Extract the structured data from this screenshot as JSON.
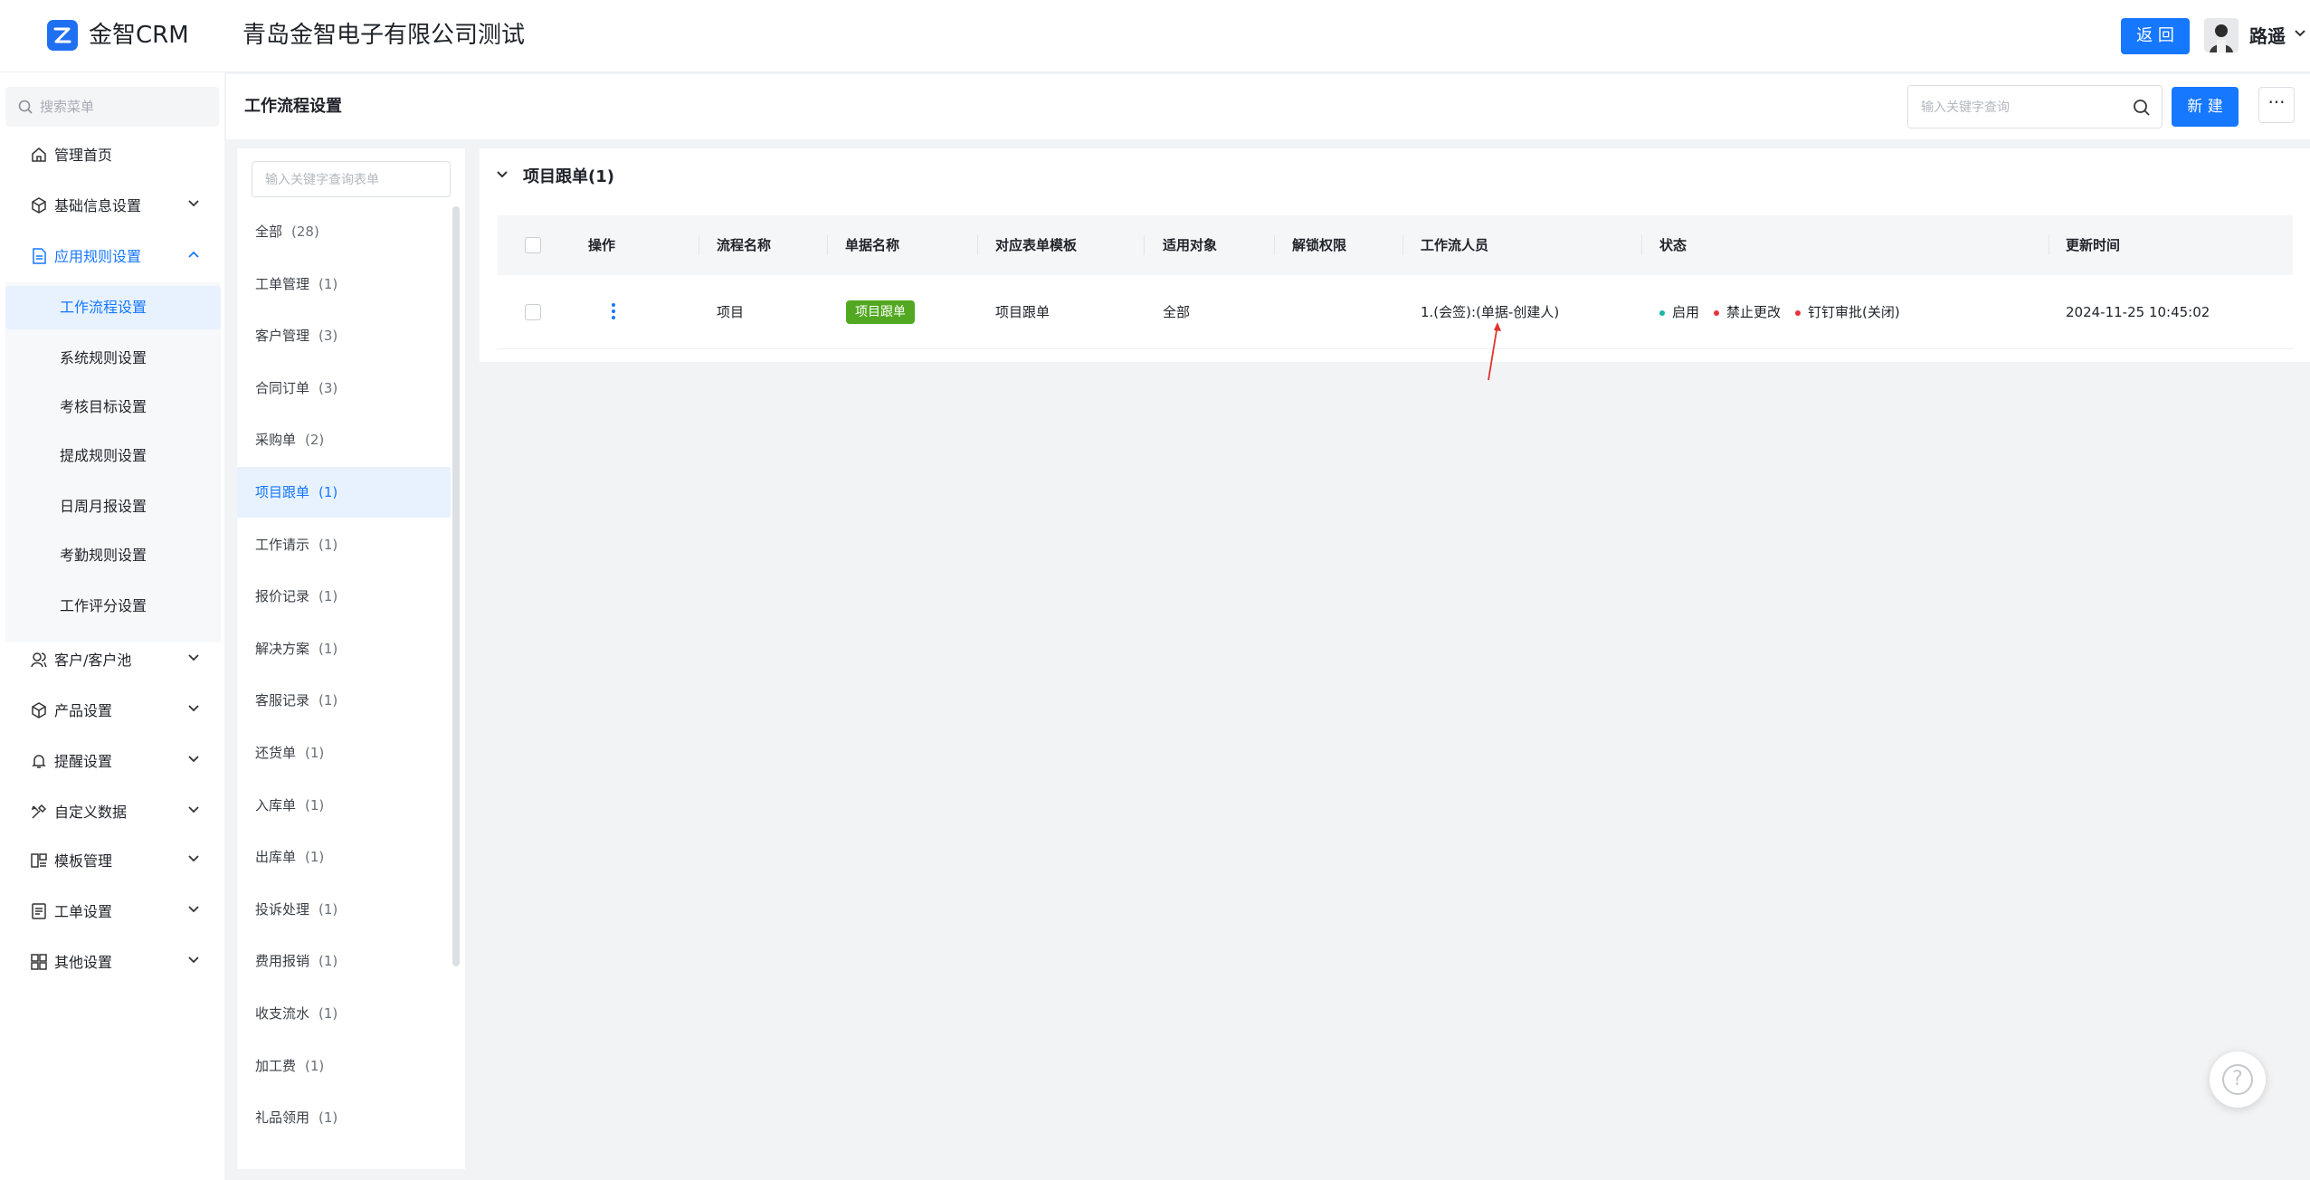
{
  "header": {
    "logo_text": "金智CRM",
    "company": "青岛金智电子有限公司测试",
    "back_label": "返 回",
    "user_name": "路遥",
    "brand_color": "#1677ff"
  },
  "sidebar": {
    "search_placeholder": "搜索菜单",
    "items": [
      {
        "label": "管理首页",
        "icon": "home-icon"
      },
      {
        "label": "基础信息设置",
        "icon": "cube-icon"
      },
      {
        "label": "应用规则设置",
        "icon": "document-icon"
      },
      {
        "label": "客户/客户池",
        "icon": "users-icon"
      },
      {
        "label": "产品设置",
        "icon": "box-icon"
      },
      {
        "label": "提醒设置",
        "icon": "bell-icon"
      },
      {
        "label": "自定义数据",
        "icon": "tools-icon"
      },
      {
        "label": "模板管理",
        "icon": "template-icon"
      },
      {
        "label": "工单设置",
        "icon": "form-icon"
      },
      {
        "label": "其他设置",
        "icon": "grid-icon"
      }
    ],
    "sub_items": [
      "工作流程设置",
      "系统规则设置",
      "考核目标设置",
      "提成规则设置",
      "日周月报设置",
      "考勤规则设置",
      "工作评分设置"
    ]
  },
  "page": {
    "title": "工作流程设置",
    "search_placeholder": "输入关键字查询",
    "new_label": "新 建",
    "more_label": "···"
  },
  "categories": {
    "search_placeholder": "输入关键字查询表单",
    "items": [
      {
        "label": "全部",
        "count": "(28)"
      },
      {
        "label": "工单管理",
        "count": "(1)"
      },
      {
        "label": "客户管理",
        "count": "(3)"
      },
      {
        "label": "合同订单",
        "count": "(3)"
      },
      {
        "label": "采购单",
        "count": "(2)"
      },
      {
        "label": "项目跟单",
        "count": "(1)"
      },
      {
        "label": "工作请示",
        "count": "(1)"
      },
      {
        "label": "报价记录",
        "count": "(1)"
      },
      {
        "label": "解决方案",
        "count": "(1)"
      },
      {
        "label": "客服记录",
        "count": "(1)"
      },
      {
        "label": "还货单",
        "count": "(1)"
      },
      {
        "label": "入库单",
        "count": "(1)"
      },
      {
        "label": "出库单",
        "count": "(1)"
      },
      {
        "label": "投诉处理",
        "count": "(1)"
      },
      {
        "label": "费用报销",
        "count": "(1)"
      },
      {
        "label": "收支流水",
        "count": "(1)"
      },
      {
        "label": "加工费",
        "count": "(1)"
      },
      {
        "label": "礼品领用",
        "count": "(1)"
      }
    ]
  },
  "section": {
    "title": "项目跟单(1)"
  },
  "table": {
    "columns": [
      "操作",
      "流程名称",
      "单据名称",
      "对应表单模板",
      "适用对象",
      "解锁权限",
      "工作流人员",
      "状态",
      "更新时间"
    ],
    "rows": [
      {
        "flow_name": "项目",
        "doc_name": "项目跟单",
        "template": "项目跟单",
        "target": "全部",
        "unlock": "",
        "staff": "1.(会签):(单据-创建人)",
        "status": [
          {
            "label": "启用",
            "color": "#19b5a5"
          },
          {
            "label": "禁止更改",
            "color": "#e5323e"
          },
          {
            "label": "钉钉审批(关闭)",
            "color": "#e5323e"
          }
        ],
        "updated": "2024-11-25 10:45:02"
      }
    ]
  }
}
